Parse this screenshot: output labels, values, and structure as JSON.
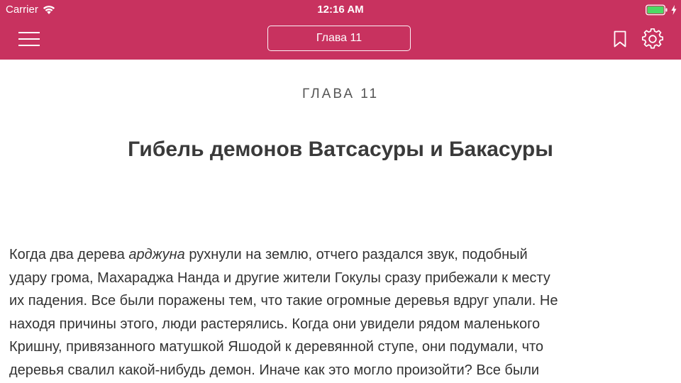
{
  "status_bar": {
    "carrier": "Carrier",
    "time": "12:16 AM",
    "wifi_icon": "wifi-icon",
    "battery_icon": "battery-icon",
    "battery_level": 1.0,
    "charging_icon": "charging-icon",
    "battery_color": "#4cd964"
  },
  "nav_bar": {
    "menu_icon": "hamburger-menu-icon",
    "chapter_button_label": "Глава 11",
    "bookmark_icon": "bookmark-icon",
    "settings_icon": "gear-icon",
    "background_color": "#c8325f"
  },
  "content": {
    "chapter_label": "ГЛАВА 11",
    "chapter_title": "Гибель демонов Ватсасуры и Бакасуры",
    "paragraph_lines": [
      {
        "before": "Когда два дерева ",
        "italic": "арджуна",
        "after": " рухнули на землю, отчего раздался звук, подобный"
      },
      {
        "before": "удару грома, Махараджа Нанда и другие жители Гокулы сразу прибежали к месту",
        "italic": "",
        "after": ""
      },
      {
        "before": "их падения. Все были поражены тем, что такие огромные деревья вдруг упали. Не",
        "italic": "",
        "after": ""
      },
      {
        "before": "находя причины этого, люди растерялись. Когда они увидели рядом маленького",
        "italic": "",
        "after": ""
      },
      {
        "before": "Кришну, привязанного матушкой Яшодой к деревянной ступе, они подумали, что",
        "italic": "",
        "after": ""
      },
      {
        "before": "деревья свалил какой-нибудь демон. Иначе как это могло произойти? Все были",
        "italic": "",
        "after": ""
      }
    ]
  }
}
